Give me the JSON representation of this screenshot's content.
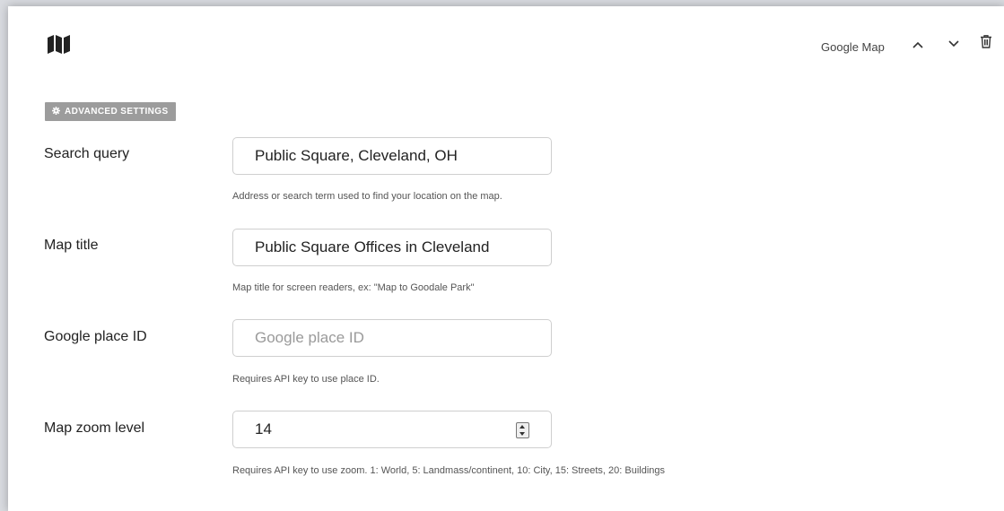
{
  "block": {
    "icon": "map-icon",
    "label": "Google Map",
    "controls": [
      "chevron-up-icon",
      "chevron-down-icon",
      "trash-icon"
    ]
  },
  "advanced_settings": {
    "icon": "gear-icon",
    "label": "ADVANCED SETTINGS"
  },
  "fields": {
    "search_query": {
      "label": "Search query",
      "value": "Public Square, Cleveland, OH",
      "help": "Address or search term used to find your location on the map."
    },
    "map_title": {
      "label": "Map title",
      "value": "Public Square Offices in Cleveland",
      "help": "Map title for screen readers, ex: \"Map to Goodale Park\""
    },
    "place_id": {
      "label": "Google place ID",
      "value": "",
      "placeholder": "Google place ID",
      "help": "Requires API key to use place ID."
    },
    "zoom": {
      "label": "Map zoom level",
      "value": "14",
      "help": "Requires API key to use zoom. 1: World, 5: Landmass/continent, 10: City, 15: Streets, 20: Buildings"
    }
  }
}
